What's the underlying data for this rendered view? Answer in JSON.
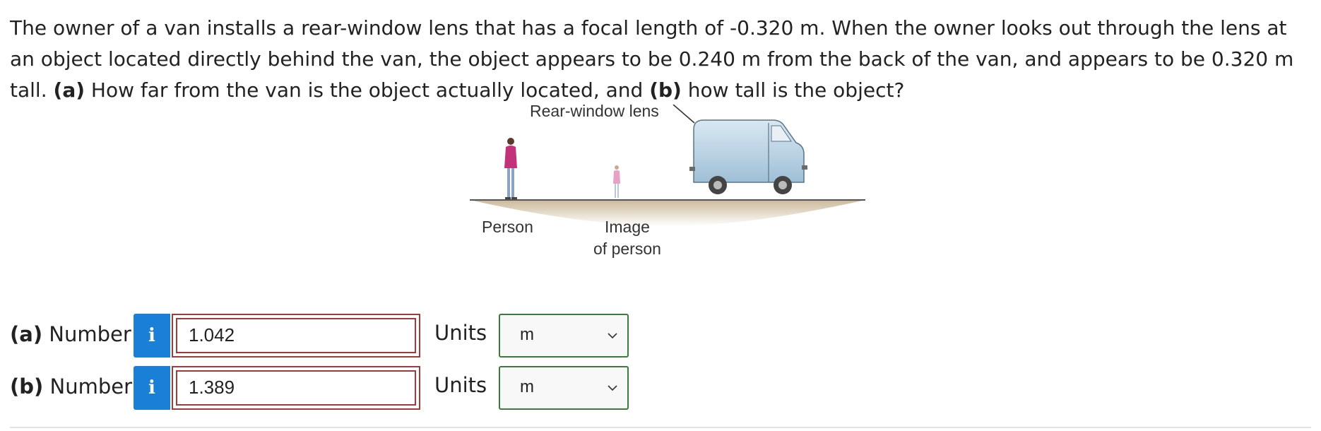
{
  "question": {
    "text_1": "The owner of a van installs a rear-window lens that has a focal length of -0.320 m. When the owner looks out through the lens at an object located directly behind the van, the object appears to be 0.240 m from the back of the van, and appears to be 0.320 m tall.",
    "part_a_marker": "(a)",
    "text_2": "How far from the van is the object actually located, and",
    "part_b_marker": "(b)",
    "text_3": "how tall is the object?"
  },
  "figure": {
    "lens_label": "Rear-window lens",
    "person_label": "Person",
    "image_label_line1": "Image",
    "image_label_line2": "of person"
  },
  "answers": [
    {
      "part": "(a)",
      "label": "Number",
      "info_icon": "i",
      "value": "1.042",
      "units_label": "Units",
      "units_value": "m"
    },
    {
      "part": "(b)",
      "label": "Number",
      "info_icon": "i",
      "value": "1.389",
      "units_label": "Units",
      "units_value": "m"
    }
  ],
  "colors": {
    "info_button": "#1a7fd6",
    "answer_border_incorrect": "#a13a3a",
    "units_border": "#3d7a3d"
  }
}
